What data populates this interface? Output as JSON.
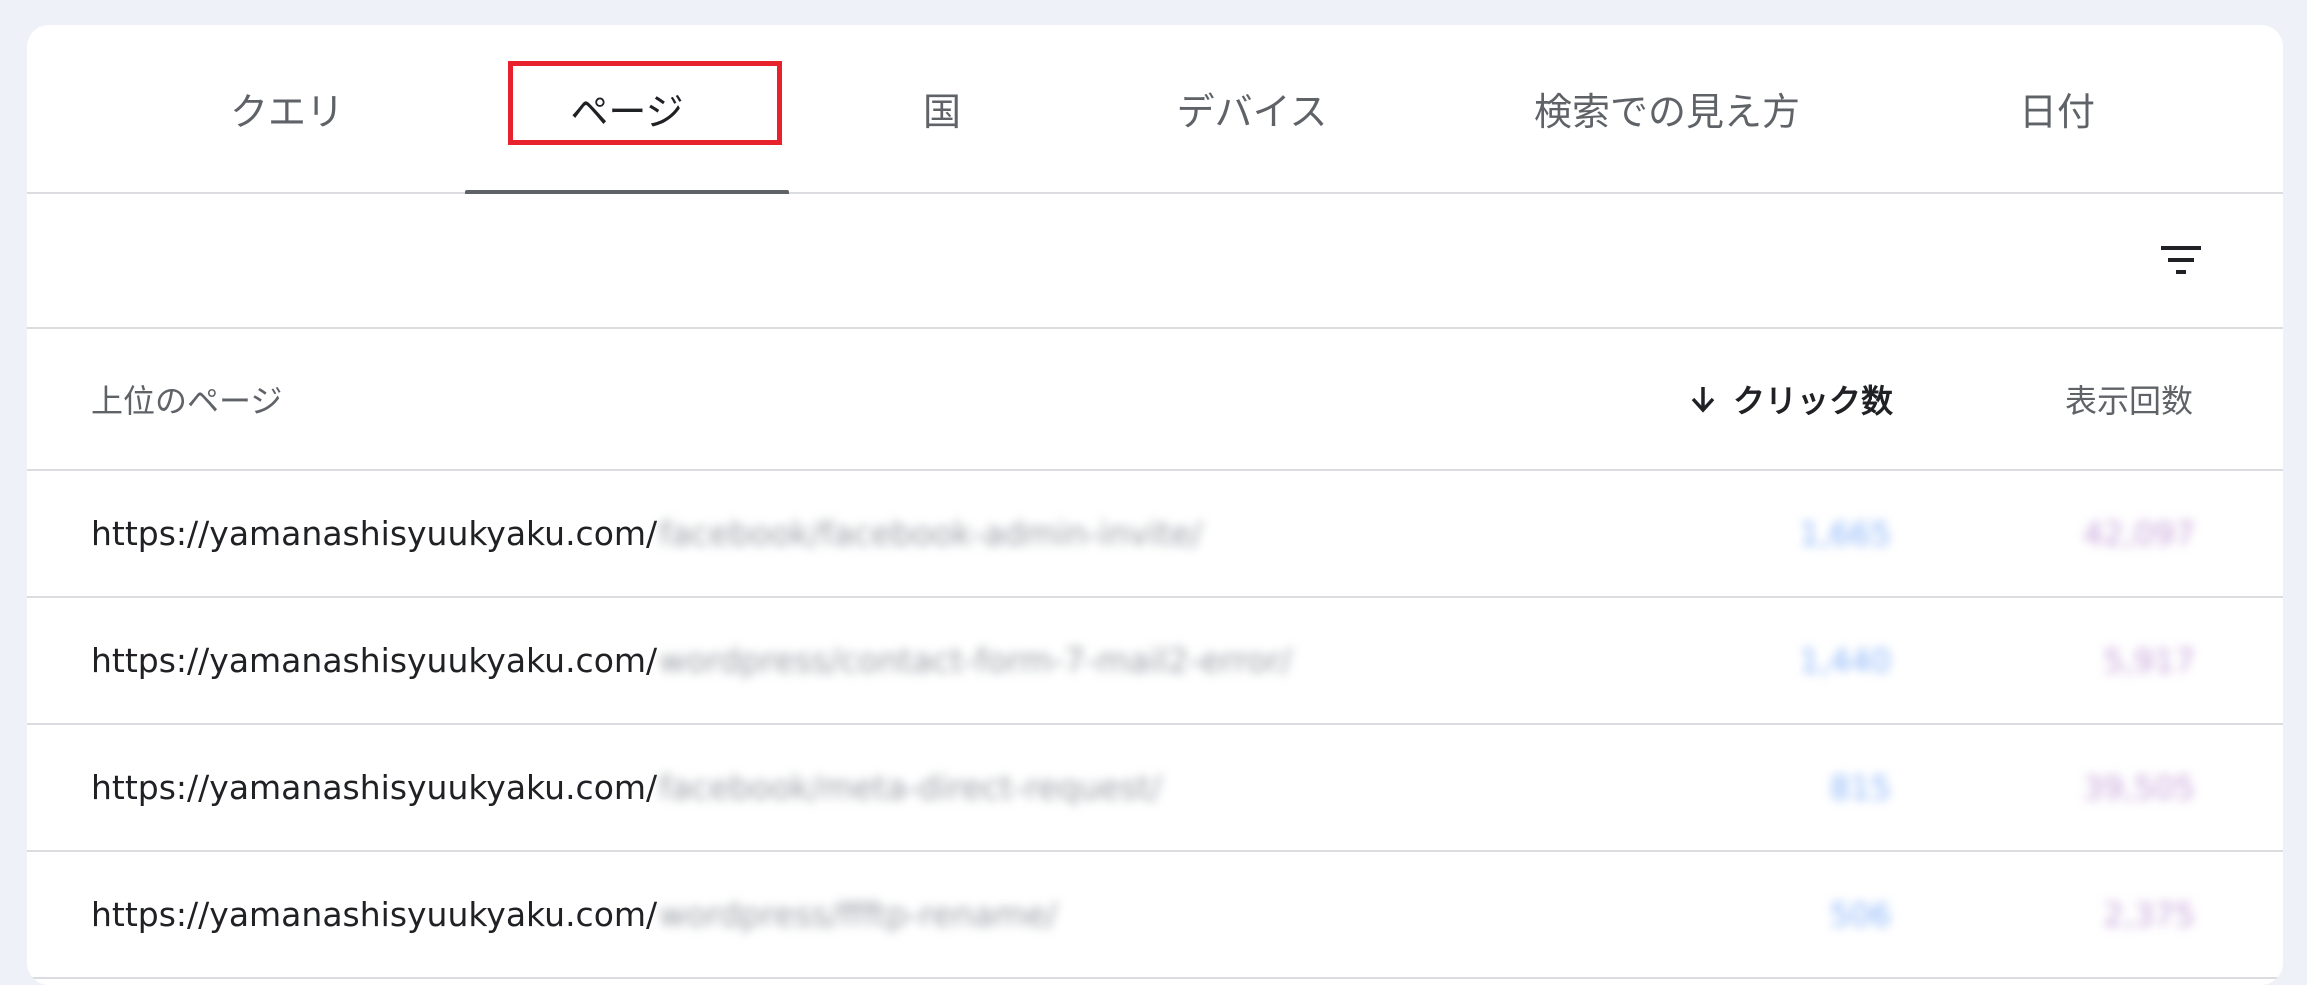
{
  "tabs": [
    {
      "label": "クエリ"
    },
    {
      "label": "ページ"
    },
    {
      "label": "国"
    },
    {
      "label": "デバイス"
    },
    {
      "label": "検索での見え方"
    },
    {
      "label": "日付"
    }
  ],
  "active_tab_index": 1,
  "table": {
    "columns": {
      "page": "上位のページ",
      "clicks": "クリック数",
      "impressions": "表示回数"
    },
    "sort": {
      "column": "clicks",
      "direction": "descending",
      "icon": "arrow-down-icon"
    },
    "rows": [
      {
        "url_prefix": "https://yamanashisyuukyaku.com/",
        "url_rest": "facebook/facebook-admin-invite/",
        "clicks": "1,665",
        "impressions": "42,097"
      },
      {
        "url_prefix": "https://yamanashisyuukyaku.com/",
        "url_rest": "wordpress/contact-form-7-mail2-error/",
        "clicks": "1,440",
        "impressions": "5,917"
      },
      {
        "url_prefix": "https://yamanashisyuukyaku.com/",
        "url_rest": "facebook/meta-direct-request/",
        "clicks": "815",
        "impressions": "39,505"
      },
      {
        "url_prefix": "https://yamanashisyuukyaku.com/",
        "url_rest": "wordpress/ffftp-rename/",
        "clicks": "506",
        "impressions": "2,375"
      }
    ]
  },
  "icons": {
    "filter": "filter-icon",
    "sort": "arrow-down-icon"
  },
  "colors": {
    "highlight": "#e8222d",
    "clicks": "#8ab4f8",
    "impressions": "#c5a3d9",
    "tab_indicator": "#5f6368"
  }
}
